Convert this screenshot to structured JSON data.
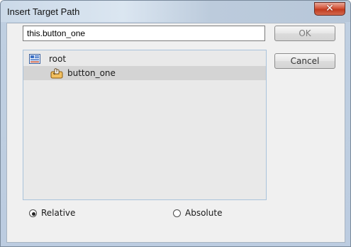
{
  "window": {
    "title": "Insert Target Path",
    "close_glyph": "✕"
  },
  "path_field": {
    "value": "this.button_one"
  },
  "buttons": {
    "ok_label": "OK",
    "cancel_label": "Cancel"
  },
  "tree": {
    "items": [
      {
        "label": "root",
        "icon": "movieclip-root-icon",
        "selected": false
      },
      {
        "label": "button_one",
        "icon": "button-symbol-icon",
        "selected": true
      }
    ]
  },
  "mode": {
    "options": [
      {
        "label": "Relative",
        "checked": true
      },
      {
        "label": "Absolute",
        "checked": false
      }
    ]
  },
  "colors": {
    "close_button": "#c8452a",
    "tree_border": "#a9c3db",
    "selected_row": "#d4d4d4"
  }
}
